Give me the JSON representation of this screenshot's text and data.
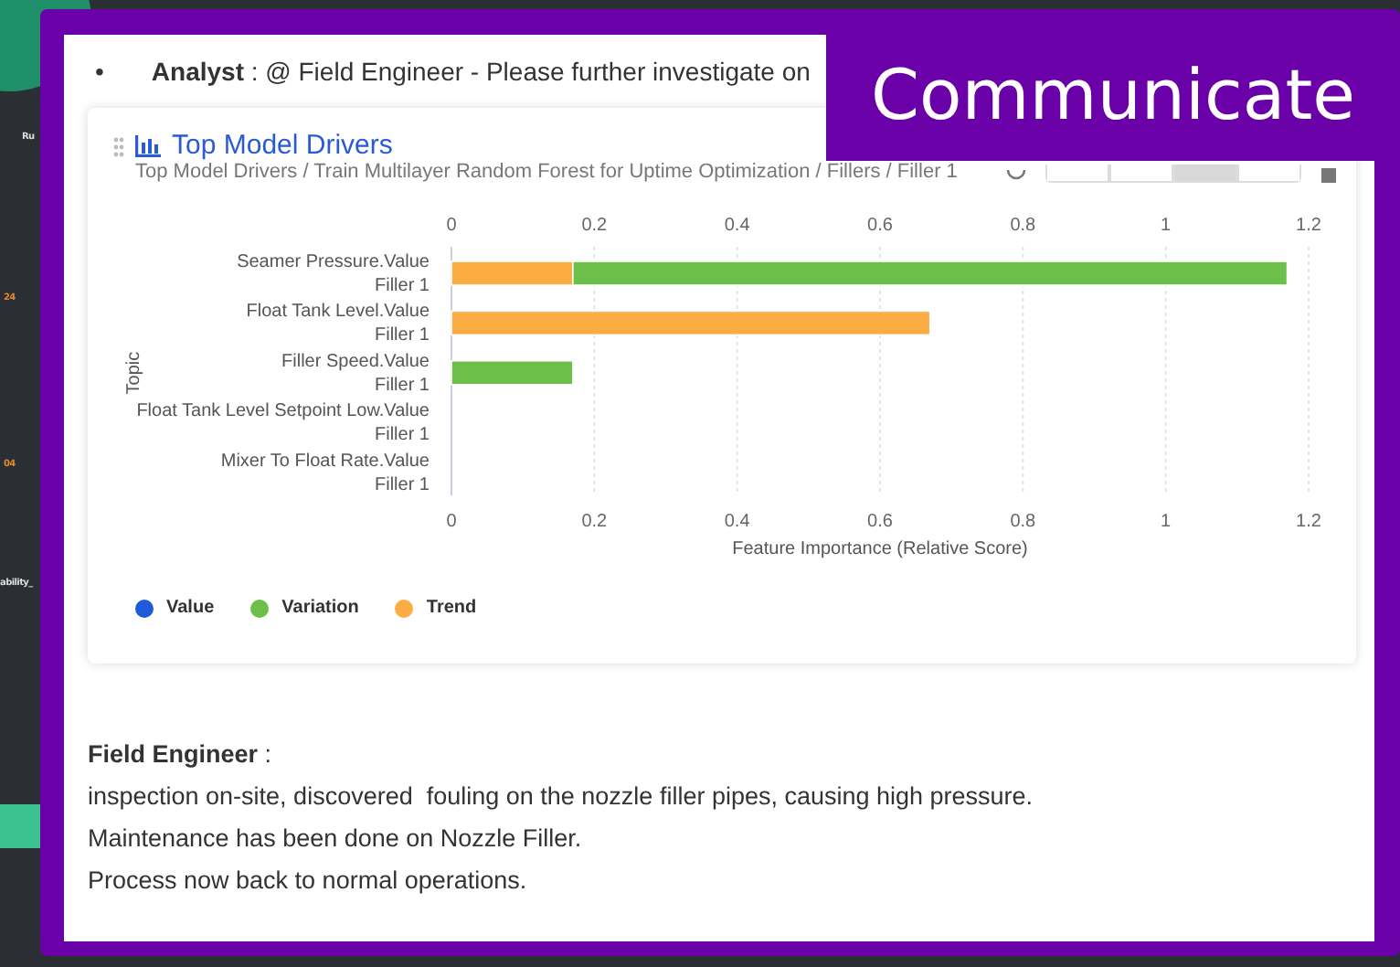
{
  "background_app": {
    "texts": [
      "Ru",
      "24",
      "04",
      "ability_"
    ]
  },
  "label": "Communicate",
  "message": {
    "bullet": "•",
    "text": "**Analyst** : @ Field Engineer - Please further investigate on"
  },
  "card": {
    "title": "Top Model Drivers",
    "breadcrumb": "Top Model Drivers / Train Multilayer Random Forest for Uptime Optimization / Fillers / Filler 1",
    "top_axis_ticks": [
      "0",
      "0.2",
      "0.4",
      "0.6",
      "0.8",
      "1",
      "1.2"
    ],
    "bottom_axis_ticks": [
      "0",
      "0.2",
      "0.4",
      "0.6",
      "0.8",
      "1",
      "1.2"
    ],
    "toolbar": [
      {
        "selected": false
      },
      {
        "selected": false
      },
      {
        "selected": true
      },
      {
        "selected": false
      }
    ],
    "chart_data": {
      "type": "bar",
      "orientation": "horizontal",
      "stacked": true,
      "xlabel": "Feature Importance (Relative Score)",
      "ylabel": "Topic",
      "categories": [
        "Seamer Pressure.Value\nFiller 1",
        "Float Tank Level.Value\nFiller 1",
        "Filler Speed.Value\nFiller 1",
        "Float Tank Level Setpoint Low.Value\nFiller 1",
        "Mixer To Float Rate.Value\nFiller 1"
      ],
      "series": [
        {
          "name": "Value",
          "color": "#1f5bd8",
          "values": [
            0,
            0,
            0,
            0,
            0
          ]
        },
        {
          "name": "Variation",
          "color": "#6cc04a",
          "values": [
            1.0,
            0,
            0.17,
            0,
            0
          ]
        },
        {
          "name": "Trend",
          "color": "#fbac43",
          "values": [
            0.17,
            0.67,
            0,
            0,
            0
          ]
        }
      ],
      "xlim": [
        0,
        1.2
      ],
      "grid": true,
      "xticks": [
        0,
        0.2,
        0.4,
        0.6,
        0.8,
        1,
        1.2
      ]
    }
  },
  "reply": {
    "author": "Field Engineer",
    "separator": ":",
    "lines": [
      "inspection on-site, discovered  fouling on the nozzle filler pipes, causing high pressure.",
      "Maintenance has been done on Nozzle Filler.",
      "Process now back to normal operations."
    ]
  }
}
